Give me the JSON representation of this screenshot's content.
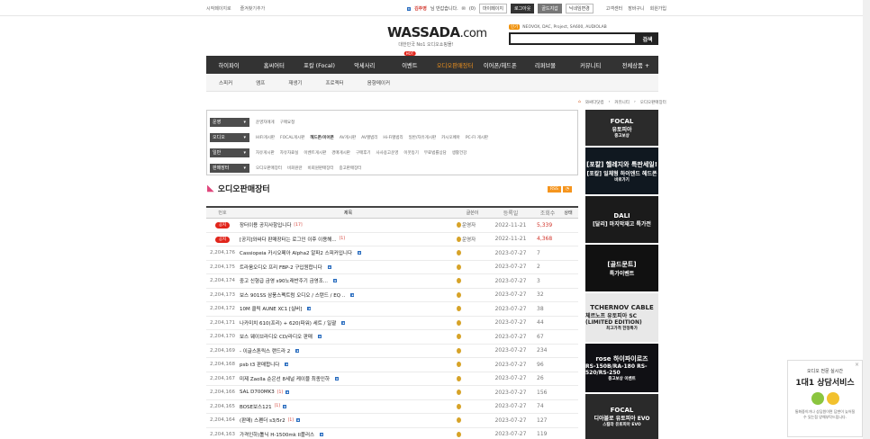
{
  "topbar": {
    "bookmark": "시작페이지로",
    "favorite": "즐겨찾기추가",
    "user_level": "B",
    "user_name": "김주영",
    "greeting": "님 반갑습니다.",
    "message_count": "(0)",
    "mypage": "마이페이지",
    "logout": "로그아웃",
    "gold": "골드지갑",
    "nickname": "닉네임변경",
    "links": [
      "고객센터",
      "장바구니",
      "회원가입"
    ]
  },
  "logo": {
    "name": "WASSADA",
    "suffix": ".com",
    "tagline": "대한민국 No1 오디오쇼핑몰!"
  },
  "search": {
    "popular_label": "인기",
    "popular": "NEOVOX, DAC, Project, SA600, AUDIOLAB",
    "button": "검색",
    "placeholder": ""
  },
  "mainnav": [
    "하이파이",
    "홈씨어터",
    "포칼 (Focal)",
    "악세사리",
    "이벤트",
    "오디오판매장터",
    "이어폰/헤드폰",
    "리퍼브몰",
    "커뮤니티",
    "전체상품 +"
  ],
  "hot_label": "HOT",
  "subnav": [
    "스피커",
    "앰프",
    "재생기",
    "프로젝터",
    "음향메이커"
  ],
  "breadcrumb": {
    "home": "와싸다닷컴",
    "sep1": "커뮤니티",
    "current": "오디오판매장터"
  },
  "categories": [
    {
      "select": "운영",
      "links": [
        "운영자에게",
        "구매요청"
      ]
    },
    {
      "select": "오디오",
      "links": [
        "HIFI게시판",
        "FOCAL게시판",
        "헤드폰/이어폰",
        "AV게시판",
        "AV앨범리",
        "Hi-Fi앨범리",
        "일반/자유게시판",
        "카시오페아",
        "PC-FI 게시판"
      ]
    },
    {
      "select": "일반",
      "links": [
        "자유게시판",
        "자유자료실",
        "이벤트게시판",
        "경매게시판",
        "구매후기",
        "사사용고운영",
        "이웃등기",
        "무료법률상담",
        "생활건강"
      ]
    },
    {
      "select": "판매장터",
      "links": [
        "오디오판매장터",
        "비회원란",
        "비회원판매장터",
        "중고판매장터"
      ]
    }
  ],
  "board_title": "오디오판매장터",
  "rss": "RSS",
  "table_headers": {
    "no": "번호",
    "subject": "제목",
    "writer": "글쓴이",
    "date": "등록일",
    "hit": "조회수",
    "state": "상태"
  },
  "rows": [
    {
      "no": "공지",
      "subject": "장터이용 공지사항입니다",
      "cmt": "[17]",
      "writer": "운영자",
      "date": "2022-11-21",
      "hit": "5,339",
      "notice": true
    },
    {
      "no": "공지",
      "subject": "[공지]와싸다 판매장터는 로그인 이후 이용해...",
      "cmt": "[1]",
      "writer": "운영자",
      "date": "2022-11-21",
      "hit": "4,368",
      "notice": true
    },
    {
      "no": "2,204,176",
      "subject": "Cassiopeia 카시오페아 Alpha2 알파2 스피커입니다",
      "cmt": "",
      "writer": "",
      "date": "2023-07-27",
      "hit": "7"
    },
    {
      "no": "2,204,175",
      "subject": "트라움오디오 프리 FBP-2 구입원합니다",
      "cmt": "",
      "writer": "",
      "date": "2023-07-27",
      "hit": "2"
    },
    {
      "no": "2,204,174",
      "subject": "중고 신형급 금영 s90노래반주기 금영조...",
      "cmt": "",
      "writer": "",
      "date": "2023-07-27",
      "hit": "3"
    },
    {
      "no": "2,204,173",
      "subject": "보스 901SS 삼풍스펙트럼 오디오 / 스탠드 / EQ ..",
      "cmt": "",
      "writer": "",
      "date": "2023-07-27",
      "hit": "32"
    },
    {
      "no": "2,204,172",
      "subject": "10M 클릭 AUNE XC1 [실버]",
      "cmt": "",
      "writer": "",
      "date": "2023-07-27",
      "hit": "38"
    },
    {
      "no": "2,204,171",
      "subject": "나카미치 610(프리) + 620(파워) 세트 / 일괄",
      "cmt": "",
      "writer": "",
      "date": "2023-07-27",
      "hit": "44"
    },
    {
      "no": "2,204,170",
      "subject": "보스 웨이브라디오 CD/라디오 판매",
      "cmt": "",
      "writer": "",
      "date": "2023-07-27",
      "hit": "67"
    },
    {
      "no": "2,204,169",
      "subject": "- 이글스톤릭스 랜드라 2",
      "cmt": "",
      "writer": "",
      "date": "2023-07-27",
      "hit": "234"
    },
    {
      "no": "2,204,168",
      "subject": "psb t3 판매합니다",
      "cmt": "",
      "writer": "",
      "date": "2023-07-27",
      "hit": "96"
    },
    {
      "no": "2,204,167",
      "subject": "미제 Zaolla 순은선 8세널 케이블 최종인하",
      "cmt": "",
      "writer": "",
      "date": "2023-07-27",
      "hit": "26"
    },
    {
      "no": "2,204,166",
      "subject": "SAL D700MK3",
      "cmt": "[1]",
      "writer": "",
      "date": "2023-07-27",
      "hit": "156"
    },
    {
      "no": "2,204,165",
      "subject": "BOSE보스121",
      "cmt": "[1]",
      "writer": "",
      "date": "2023-07-27",
      "hit": "74"
    },
    {
      "no": "2,204,164",
      "subject": "(판매) 스펜더 s3/5r2",
      "cmt": "[1]",
      "writer": "",
      "date": "2023-07-27",
      "hit": "127"
    },
    {
      "no": "2,204,163",
      "subject": "가격인하)톨닉 H-1500mk II플러스",
      "cmt": "",
      "writer": "",
      "date": "2023-07-27",
      "hit": "119"
    }
  ],
  "ads": [
    {
      "t1": "FOCAL",
      "t2": "유토피아",
      "t3": "중고보상",
      "bg": "#2b2b2b"
    },
    {
      "t1": "[포칼] 헬레지와 특판세일!",
      "t2": "[포칼] 일체형 하이엔드 헤드폰",
      "t3": "바로가기",
      "bg": "#101820"
    },
    {
      "t1": "DALI",
      "t2": "[달리] 마지막재고 특가전",
      "t3": "",
      "bg": "#1b1b1b"
    },
    {
      "t1": "[골드문트]",
      "t2": "특가이벤트",
      "t3": "",
      "bg": "#111"
    },
    {
      "t1": "TCHERNOV CABLE",
      "t2": "체르노프 유토피아 SC (LIMITED EDITION)",
      "t3": "최고가격 한정특가",
      "bg": "#e8e8e8"
    },
    {
      "t1": "rose 하이파이로즈",
      "t2": "RS-150B/RA-180 RS-520/RS-250",
      "t3": "중고보상 이벤트",
      "bg": "#101014"
    },
    {
      "t1": "FOCAL",
      "t2": "디아블로 유토피아 EVO",
      "t3": "스칼라 유토피아 EVO",
      "bg": "#2a2a2a"
    }
  ],
  "chat": {
    "l1": "오디오 전문 실시간",
    "l2": "1대1 상담서비스",
    "l3": "통화중이거나 상담원이면 답변이 늦어질수 있는점 양해부탁드립니다.",
    "close": "×"
  }
}
